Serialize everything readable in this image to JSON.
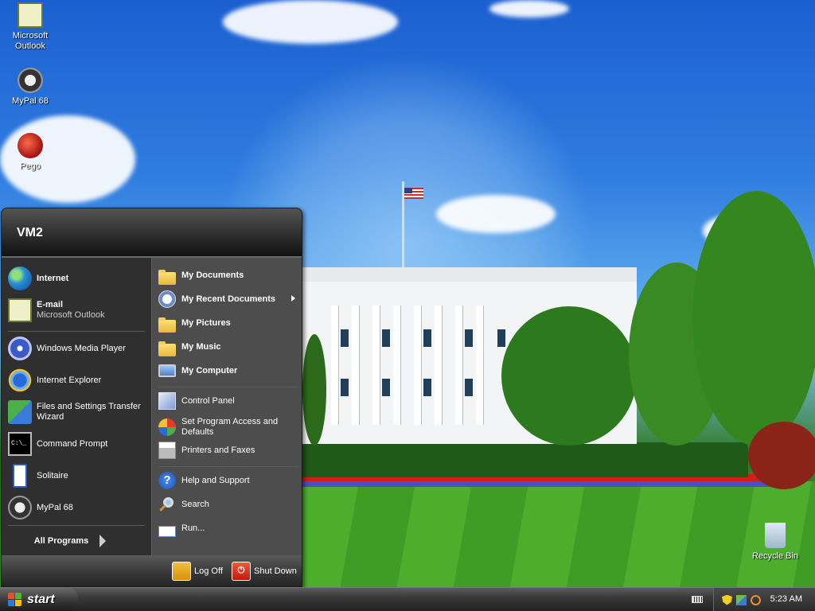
{
  "desktop": {
    "icons": [
      {
        "label": "Microsoft Outlook"
      },
      {
        "label": "MyPal 68"
      },
      {
        "label": "Pego"
      },
      {
        "label": "Recycle Bin"
      }
    ]
  },
  "start_menu": {
    "user": "VM2",
    "pinned": [
      {
        "label": "Internet",
        "icon": "globe-icon"
      },
      {
        "label": "E-mail",
        "sub": "Microsoft Outlook",
        "icon": "outlook-icon"
      }
    ],
    "recent": [
      {
        "label": "Windows Media Player",
        "icon": "media-player-icon"
      },
      {
        "label": "Internet Explorer",
        "icon": "ie-icon"
      },
      {
        "label": "Files and Settings Transfer Wizard",
        "icon": "transfer-wizard-icon"
      },
      {
        "label": "Command Prompt",
        "icon": "command-prompt-icon"
      },
      {
        "label": "Solitaire",
        "icon": "solitaire-icon"
      },
      {
        "label": "MyPal 68",
        "icon": "mypal-icon"
      }
    ],
    "all_programs": "All Programs",
    "places": [
      {
        "label": "My Documents",
        "icon": "folder-icon"
      },
      {
        "label": "My Recent Documents",
        "icon": "recent-docs-icon"
      },
      {
        "label": "My Pictures",
        "icon": "folder-icon"
      },
      {
        "label": "My Music",
        "icon": "folder-icon"
      },
      {
        "label": "My Computer",
        "icon": "computer-icon"
      }
    ],
    "system": [
      {
        "label": "Control Panel",
        "icon": "control-panel-icon"
      },
      {
        "label": "Set Program Access and Defaults",
        "icon": "program-access-icon"
      },
      {
        "label": "Printers and Faxes",
        "icon": "printer-icon"
      }
    ],
    "tools": [
      {
        "label": "Help and Support",
        "icon": "help-icon"
      },
      {
        "label": "Search",
        "icon": "search-icon"
      },
      {
        "label": "Run...",
        "icon": "run-icon"
      }
    ],
    "log_off": "Log Off",
    "shut_down": "Shut Down"
  },
  "taskbar": {
    "start_label": "start",
    "clock": "5:23 AM"
  }
}
